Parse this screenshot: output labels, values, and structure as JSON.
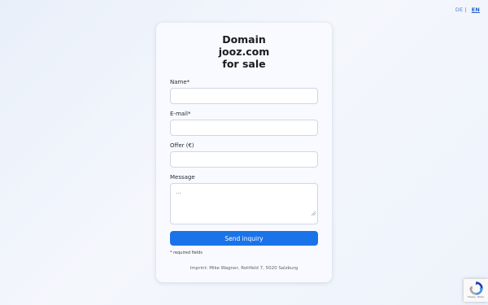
{
  "language_switch": {
    "de_label": "DE",
    "separator": "|",
    "en_label": "EN",
    "active": "EN"
  },
  "form": {
    "title_line1": "Domain",
    "title_line2": "jooz.com",
    "title_line3": "for sale",
    "name_label": "Name*",
    "email_label": "E-mail*",
    "offer_label": "Offer (€)",
    "message_label": "Message",
    "message_placeholder": "...",
    "send_button_label": "Send inquiry",
    "required_note": "* required fields",
    "imprint": "Imprint: Mike Wagner, Rottfeld 7, 5020 Salzburg"
  },
  "recaptcha": {
    "icon": "recaptcha-icon",
    "links": "Privacy - Terms"
  },
  "colors": {
    "accent": "#1a73e8",
    "card_background": "#f8faff",
    "page_background": "#eef3fb"
  }
}
